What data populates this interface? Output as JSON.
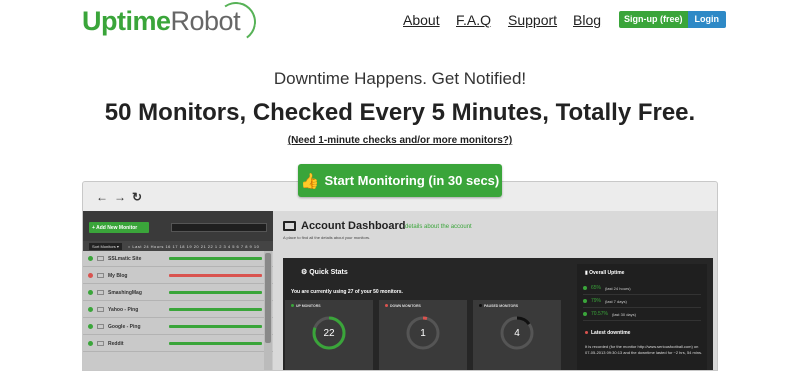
{
  "header": {
    "logo_part1": "Uptime",
    "logo_part2": "Robot",
    "nav": [
      "About",
      "F.A.Q",
      "Support",
      "Blog"
    ],
    "signup_label": "Sign-up (free)",
    "login_label": "Login"
  },
  "hero": {
    "tagline": "Downtime Happens. Get Notified!",
    "headline": "50 Monitors, Checked Every 5 Minutes, Totally Free.",
    "subnote": "(Need 1-minute checks and/or more monitors?)",
    "cta_label": "Start Monitoring (in 30 secs)",
    "cta_icon": "thumbs-up-icon"
  },
  "colors": {
    "brand_green": "#3aa53a",
    "login_blue": "#2e89c6",
    "down_red": "#d9534f",
    "paused_black": "#111111"
  },
  "app": {
    "add_monitor": "+ Add New Monitor",
    "sort_label": "Sort Monitors ▾",
    "timeline": "○ Last 24 Hours  16  17  18  19  20  21  22  1  2  3  4  5  6  7  8  9  10",
    "monitors": [
      {
        "name": "SSLmatic Site",
        "status": "up"
      },
      {
        "name": "My Blog",
        "status": "down"
      },
      {
        "name": "SmashingMag",
        "status": "up"
      },
      {
        "name": "Yahoo - Ping",
        "status": "up"
      },
      {
        "name": "Google - Ping",
        "status": "up"
      },
      {
        "name": "Reddit",
        "status": "up"
      }
    ],
    "dashboard_title": "Account Dashboard",
    "dashboard_sub": "details about the account",
    "dashboard_desc": "A place to find all the details about your monitors.",
    "quick_stats_title": "Quick Stats",
    "usage_text": "You are currently using 27 of your 50 monitors.",
    "stats": [
      {
        "label": "UP MONITORS",
        "value": "22",
        "color": "#3aa53a"
      },
      {
        "label": "DOWN MONITORS",
        "value": "1",
        "color": "#d9534f"
      },
      {
        "label": "PAUSED MONITORS",
        "value": "4",
        "color": "#111111"
      }
    ],
    "overall_uptime_title": "Overall Uptime",
    "uptime_rows": [
      {
        "pct": "65%",
        "period": "(last 24 hours)"
      },
      {
        "pct": "79%",
        "period": "(last 7 days)"
      },
      {
        "pct": "70.57%",
        "period": "(last 30 days)"
      }
    ],
    "latest_downtime_title": "Latest downtime",
    "latest_downtime_text": "It is recorded (for the monitor http://www.seriousfootball.com) on 07-05-2013 09:30:13 and the downtime lasted for ~2 hrs, 54 mins."
  }
}
